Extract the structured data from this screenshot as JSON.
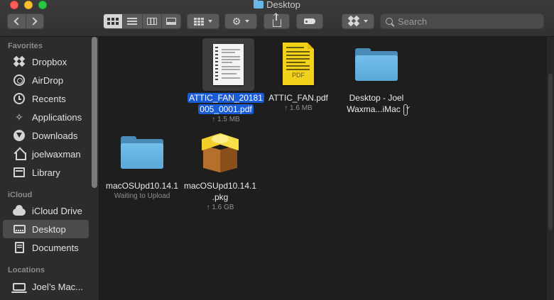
{
  "window": {
    "title": "Desktop"
  },
  "toolbar": {
    "back_label": "Back",
    "forward_label": "Forward",
    "view_modes": [
      "icon",
      "list",
      "column",
      "gallery"
    ],
    "active_view": "icon",
    "search_placeholder": "Search"
  },
  "sidebar": {
    "favorites_header": "Favorites",
    "favorites": [
      {
        "label": "Dropbox",
        "icon": "dropbox-icon"
      },
      {
        "label": "AirDrop",
        "icon": "airdrop-icon"
      },
      {
        "label": "Recents",
        "icon": "clock-icon"
      },
      {
        "label": "Applications",
        "icon": "applications-icon"
      },
      {
        "label": "Downloads",
        "icon": "downloads-icon"
      },
      {
        "label": "joelwaxman",
        "icon": "home-icon"
      },
      {
        "label": "Library",
        "icon": "library-icon"
      }
    ],
    "icloud_header": "iCloud",
    "icloud": [
      {
        "label": "iCloud Drive",
        "icon": "cloud-icon"
      },
      {
        "label": "Desktop",
        "icon": "desktop-icon",
        "selected": true
      },
      {
        "label": "Documents",
        "icon": "document-icon"
      }
    ],
    "locations_header": "Locations",
    "locations": [
      {
        "label": "Joel’s Mac...",
        "icon": "computer-icon"
      }
    ]
  },
  "files": [
    {
      "name_line1": "ATTIC_FAN_20181",
      "name_line2": "005_0001.pdf",
      "meta": "↑ 1.5 MB",
      "selected": true,
      "kind": "pdf-scan"
    },
    {
      "name_line1": "ATTIC_FAN.pdf",
      "name_line2": "",
      "meta": "↑ 1.6 MB",
      "selected": false,
      "kind": "pdf",
      "thumb_label": "PDF"
    },
    {
      "name_line1": "Desktop - Joel",
      "name_line2": "Waxma...iMac",
      "meta": "",
      "selected": false,
      "kind": "folder",
      "cloud_badge": true
    },
    {
      "name_line1": "macOSUpd10.14.1",
      "name_line2": "",
      "meta": "Waiting to Upload",
      "selected": false,
      "kind": "folder"
    },
    {
      "name_line1": "macOSUpd10.14.1",
      "name_line2": ".pkg",
      "meta": "↑ 1.6 GB",
      "selected": false,
      "kind": "package"
    }
  ]
}
